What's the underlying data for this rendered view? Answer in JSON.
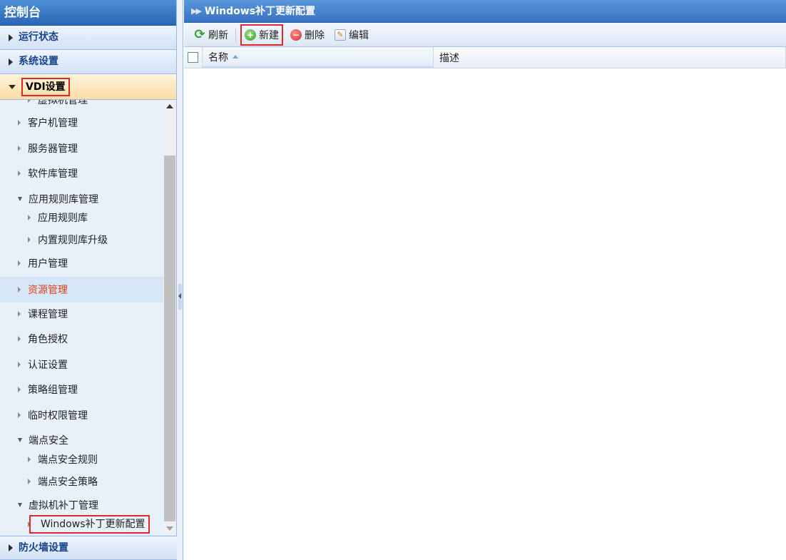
{
  "sidebar": {
    "title": "控制台",
    "sections": {
      "running": "运行状态",
      "system": "系统设置",
      "vdi": "VDI设置",
      "firewall": "防火墙设置"
    },
    "tree": {
      "vm_manage": "虚拟机管理",
      "client_manage": "客户机管理",
      "server_manage": "服务器管理",
      "software_lib": "软件库管理",
      "app_rule_lib_manage": "应用规则库管理",
      "app_rule_lib": "应用规则库",
      "builtin_rule_upgrade": "内置规则库升级",
      "user_manage": "用户管理",
      "resource_manage": "资源管理",
      "course_manage": "课程管理",
      "role_auth": "角色授权",
      "auth_settings": "认证设置",
      "policy_group": "策略组管理",
      "temp_permission": "临时权限管理",
      "endpoint_security": "端点安全",
      "endpoint_rules": "端点安全规则",
      "endpoint_policy": "端点安全策略",
      "vm_patch_manage": "虚拟机补丁管理",
      "windows_patch_config": "Windows补丁更新配置"
    }
  },
  "main": {
    "header_title": "Windows补丁更新配置",
    "toolbar": {
      "refresh": "刷新",
      "new": "新建",
      "delete": "删除",
      "edit": "编辑"
    },
    "grid": {
      "columns": [
        "名称",
        "描述"
      ]
    }
  }
}
